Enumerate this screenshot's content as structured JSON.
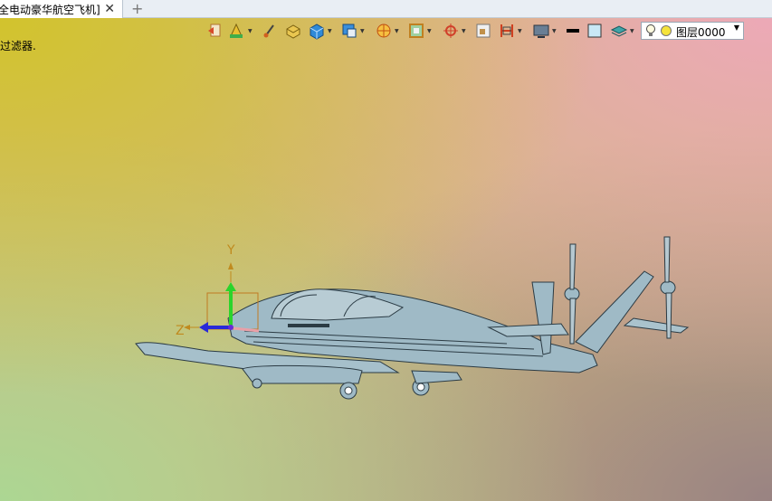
{
  "tab": {
    "title": "全电动豪华航空飞机]",
    "close_glyph": "✕",
    "add_glyph": "+"
  },
  "viewport": {
    "filter_text": "过滤器.",
    "layer_name": "图层0000"
  },
  "axes": {
    "y_label": "Y",
    "z_label": "Z"
  },
  "toolbar_icons": [
    "back-view-icon",
    "measure-icon",
    "brush-icon",
    "shaded-box-icon",
    "solid-cube-icon",
    "view-cube-icon",
    "section-icon",
    "frame-icon",
    "snap-target-icon",
    "fit-view-icon",
    "clip-icon",
    "display-icon",
    "line-color-icon",
    "fill-color-icon",
    "layer-stack-icon"
  ],
  "colors": {
    "model": "#9fbac6",
    "model_edges": "#2b3b44",
    "y_axis": "#2bd42b",
    "z_axis": "#2a2ad8",
    "axis_label": "#c08a1e"
  }
}
